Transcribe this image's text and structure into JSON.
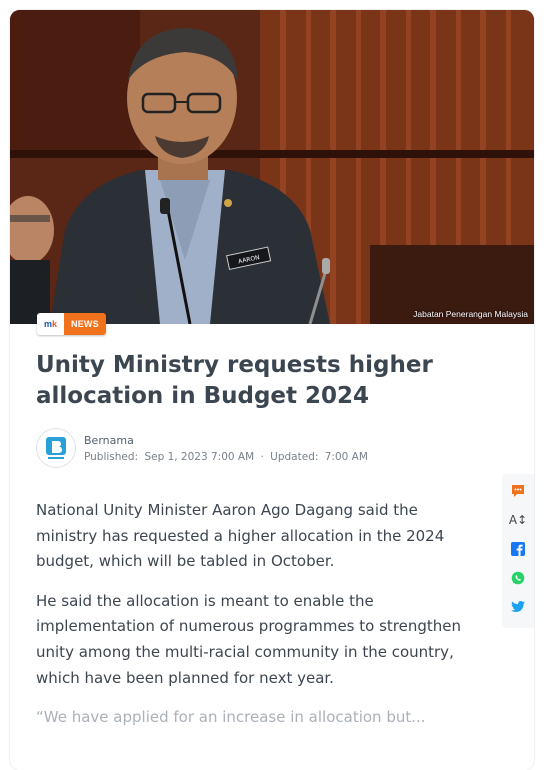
{
  "hero": {
    "credit": "Jabatan Penerangan Malaysia",
    "name_plate": "AARON"
  },
  "tag": {
    "logo": "mk",
    "label": "NEWS"
  },
  "article": {
    "title": "Unity Ministry requests higher allocation in Budget 2024",
    "source_name": "Bernama",
    "published_label": "Published:",
    "published_value": "Sep 1, 2023 7:00 AM",
    "separator": "·",
    "updated_label": "Updated:",
    "updated_value": "7:00 AM",
    "paragraphs": [
      "National Unity Minister Aaron Ago Dagang said the ministry has requested a higher allocation in the 2024 budget, which will be tabled in October.",
      "He said the allocation is meant to enable the implementation of numerous programmes to strengthen unity among the multi-racial community in the country, which have been planned for next year.",
      "“We have applied for an increase in allocation but..."
    ]
  },
  "toolbar": {
    "items": [
      "comment-icon",
      "font-size-icon",
      "facebook-icon",
      "whatsapp-icon",
      "twitter-icon"
    ],
    "font_label": "A↕"
  },
  "colors": {
    "accent": "#f2711c",
    "title": "#3c4651",
    "bernama_blue": "#2a9fd8",
    "facebook": "#1877f2",
    "whatsapp": "#25d366",
    "twitter": "#1da1f2"
  }
}
